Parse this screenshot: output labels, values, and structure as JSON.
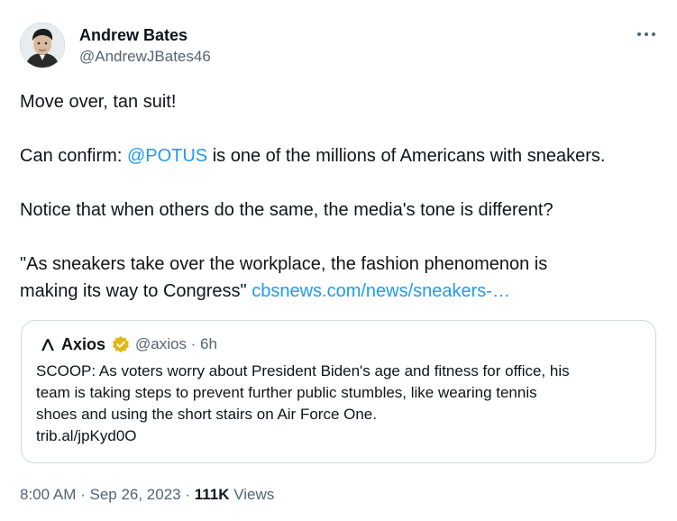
{
  "author": {
    "name": "Andrew Bates",
    "handle": "@AndrewJBates46"
  },
  "tweet": {
    "line1": "Move over, tan suit!",
    "line2_prefix": "Can confirm: ",
    "line2_mention": "@POTUS",
    "line2_suffix": " is one of the millions of Americans with sneakers.",
    "line3": "Notice that when others do the same, the media's tone is different?",
    "line4a": "\"As sneakers take over the workplace, the fashion phenomenon is",
    "line4b_prefix": "making its way to Congress\" ",
    "line4b_link": "cbsnews.com/news/sneakers-…"
  },
  "quote": {
    "name": "Axios",
    "meta": "@axios · 6h",
    "line1": "SCOOP: As voters worry about President Biden's age and fitness for office, his",
    "line2": "team is taking steps to prevent further public stumbles, like wearing tennis",
    "line3": "shoes and using the short stairs on Air Force One.",
    "line4": "trib.al/jpKyd0O"
  },
  "footer": {
    "time": "8:00 AM",
    "sep1": " · ",
    "date": "Sep 26, 2023",
    "sep2": " · ",
    "views_count": "111K",
    "views_label": " Views"
  },
  "colors": {
    "link": "#1d9bf0",
    "muted": "#536471",
    "text": "#0f1419",
    "border": "#cfd9de",
    "verified_gold": "#e2b719"
  },
  "icons": {
    "more": "more-horizontal-icon",
    "axios_logo": "axios-logo-icon",
    "verified": "verified-badge-icon"
  }
}
